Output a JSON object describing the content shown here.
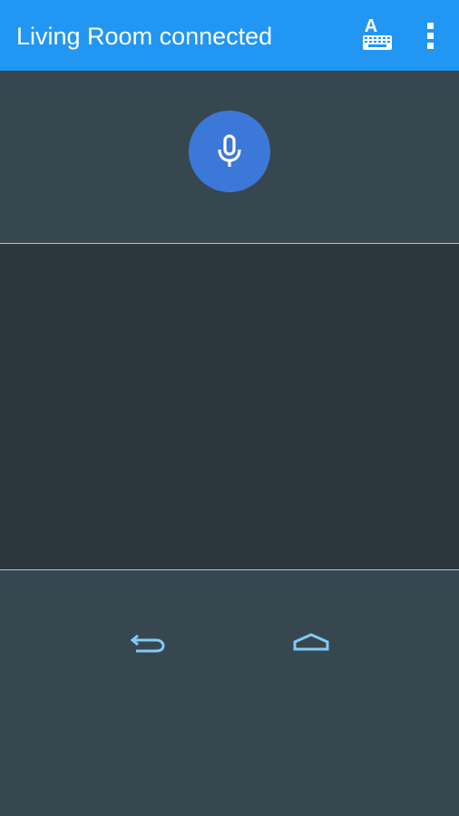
{
  "app_bar": {
    "title": "Living Room connected",
    "background_color": "#2196f3",
    "actions": [
      {
        "icon": "keyboard-icon"
      },
      {
        "icon": "overflow-menu-icon"
      }
    ]
  },
  "voice": {
    "icon": "microphone-icon",
    "button_color": "#3b78d8"
  },
  "touchpad": {
    "background_color": "#2c363d"
  },
  "navigation": {
    "back_icon": "back-arrow-icon",
    "home_icon": "home-icon",
    "icon_color": "#80cbf5"
  },
  "colors": {
    "panel": "#37474f",
    "divider": "#a9c7d2"
  }
}
